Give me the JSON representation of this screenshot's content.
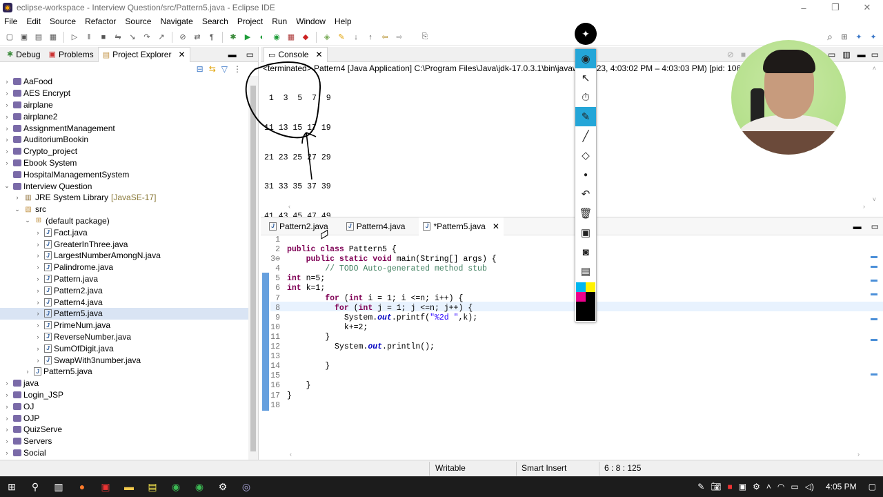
{
  "window": {
    "title": "eclipse-workspace - Interview Question/src/Pattern5.java - Eclipse IDE",
    "controls": [
      "–",
      "❐",
      "✕"
    ]
  },
  "menu": [
    "File",
    "Edit",
    "Source",
    "Refactor",
    "Source",
    "Navigate",
    "Search",
    "Project",
    "Run",
    "Window",
    "Help"
  ],
  "left_panel": {
    "tabs": [
      {
        "label": "Debug"
      },
      {
        "label": "Problems"
      },
      {
        "label": "Project Explorer",
        "close": "✕"
      }
    ],
    "tree": [
      {
        "label": "AaFood",
        "indent": 0,
        "type": "project"
      },
      {
        "label": "AES Encrypt",
        "indent": 0,
        "type": "project"
      },
      {
        "label": "airplane",
        "indent": 0,
        "type": "project"
      },
      {
        "label": "airplane2",
        "indent": 0,
        "type": "project"
      },
      {
        "label": "AssignmentManagement",
        "indent": 0,
        "type": "project"
      },
      {
        "label": "AuditoriumBookin",
        "indent": 0,
        "type": "project"
      },
      {
        "label": "Crypto_project",
        "indent": 0,
        "type": "project"
      },
      {
        "label": "Ebook System",
        "indent": 0,
        "type": "project"
      },
      {
        "label": "HospitalManagementSystem",
        "indent": 0,
        "type": "project-noarrow"
      },
      {
        "label": "Interview Question",
        "indent": 0,
        "type": "project-open"
      },
      {
        "label": "JRE System Library",
        "suffix": "[JavaSE-17]",
        "indent": 1,
        "type": "jre"
      },
      {
        "label": "src",
        "indent": 1,
        "type": "src-open"
      },
      {
        "label": "(default package)",
        "indent": 2,
        "type": "pkg-open"
      },
      {
        "label": "Fact.java",
        "indent": 3,
        "type": "java"
      },
      {
        "label": "GreaterInThree.java",
        "indent": 3,
        "type": "java"
      },
      {
        "label": "LargestNumberAmongN.java",
        "indent": 3,
        "type": "java"
      },
      {
        "label": "Palindrome.java",
        "indent": 3,
        "type": "java"
      },
      {
        "label": "Pattern.java",
        "indent": 3,
        "type": "java"
      },
      {
        "label": "Pattern2.java",
        "indent": 3,
        "type": "java"
      },
      {
        "label": "Pattern4.java",
        "indent": 3,
        "type": "java"
      },
      {
        "label": "Pattern5.java",
        "indent": 3,
        "type": "java",
        "selected": true
      },
      {
        "label": "PrimeNum.java",
        "indent": 3,
        "type": "java"
      },
      {
        "label": "ReverseNumber.java",
        "indent": 3,
        "type": "java"
      },
      {
        "label": "SumOfDigit.java",
        "indent": 3,
        "type": "java"
      },
      {
        "label": "SwapWith3number.java",
        "indent": 3,
        "type": "java"
      },
      {
        "label": "Pattern5.java",
        "indent": 2,
        "type": "java"
      },
      {
        "label": "java",
        "indent": 0,
        "type": "project"
      },
      {
        "label": "Login_JSP",
        "indent": 0,
        "type": "project"
      },
      {
        "label": "OJ",
        "indent": 0,
        "type": "project"
      },
      {
        "label": "OJP",
        "indent": 0,
        "type": "project"
      },
      {
        "label": "QuizServe",
        "indent": 0,
        "type": "project"
      },
      {
        "label": "Servers",
        "indent": 0,
        "type": "project"
      },
      {
        "label": "Social",
        "indent": 0,
        "type": "project"
      }
    ]
  },
  "console": {
    "tab_label": "Console",
    "header": "<terminated> Pattern4 [Java Application] C:\\Program Files\\Java\\jdk-17.0.3.1\\bin\\javaw.exe",
    "header_tail": "7, 2023, 4:03:02 PM – 4:03:03 PM) [pid: 1065",
    "output_rows": [
      " 1  3  5  7  9",
      "11 13 15 17 19",
      "21 23 25 27 29",
      "31 33 35 37 39",
      "41 43 45 47 49"
    ]
  },
  "editor": {
    "tabs": [
      {
        "label": "Pattern2.java"
      },
      {
        "label": "Pattern4.java"
      },
      {
        "label": "*Pattern5.java",
        "active": true,
        "close": "✕"
      }
    ],
    "line_numbers": [
      "1",
      "2",
      "3⊖",
      "4",
      "5",
      "6",
      "7",
      "8",
      "9",
      "10",
      "11",
      "12",
      "13",
      "14",
      "15",
      "16",
      "17",
      "18"
    ],
    "code_lines": [
      {
        "t": [
          {
            "s": ""
          }
        ]
      },
      {
        "t": [
          {
            "s": "public class ",
            "c": "kw"
          },
          {
            "s": "Pattern5 {"
          }
        ]
      },
      {
        "t": [
          {
            "s": "    "
          },
          {
            "s": "public static void ",
            "c": "kw"
          },
          {
            "s": "main(String[] args) {"
          }
        ]
      },
      {
        "t": [
          {
            "s": "        "
          },
          {
            "s": "// TODO Auto-generated method stub",
            "c": "cm"
          }
        ]
      },
      {
        "t": [
          {
            "s": "int ",
            "c": "kw"
          },
          {
            "s": "n=5;"
          }
        ]
      },
      {
        "t": [
          {
            "s": "int ",
            "c": "kw"
          },
          {
            "s": "k=1;"
          }
        ]
      },
      {
        "t": [
          {
            "s": "        "
          },
          {
            "s": "for ",
            "c": "kw"
          },
          {
            "s": "("
          },
          {
            "s": "int ",
            "c": "kw"
          },
          {
            "s": "i = 1; i <=n; i++) {"
          }
        ]
      },
      {
        "t": [
          {
            "s": "          "
          },
          {
            "s": "for ",
            "c": "kw"
          },
          {
            "s": "("
          },
          {
            "s": "int ",
            "c": "kw"
          },
          {
            "s": "j = 1; j <=n; j++) {"
          }
        ]
      },
      {
        "t": [
          {
            "s": "            System."
          },
          {
            "s": "out",
            "c": "it"
          },
          {
            "s": ".printf("
          },
          {
            "s": "\"%2d \"",
            "c": "st"
          },
          {
            "s": ",k);"
          }
        ]
      },
      {
        "t": [
          {
            "s": "            k+=2;"
          }
        ]
      },
      {
        "t": [
          {
            "s": "        }"
          }
        ]
      },
      {
        "t": [
          {
            "s": "          System."
          },
          {
            "s": "out",
            "c": "it"
          },
          {
            "s": ".println();"
          }
        ]
      },
      {
        "t": [
          {
            "s": ""
          }
        ]
      },
      {
        "t": [
          {
            "s": "        }"
          }
        ]
      },
      {
        "t": [
          {
            "s": ""
          }
        ]
      },
      {
        "t": [
          {
            "s": "    }"
          }
        ]
      },
      {
        "t": [
          {
            "s": "}"
          }
        ]
      },
      {
        "t": [
          {
            "s": ""
          }
        ]
      }
    ]
  },
  "status": {
    "writable": "Writable",
    "insert_mode": "Smart Insert",
    "position": "6 : 8 : 125"
  },
  "taskbar": {
    "time": "4:05 PM"
  },
  "annotation_tools": [
    "eye-icon",
    "cursor-icon",
    "timer-icon",
    "highlighter-icon",
    "pen-icon",
    "eraser-icon",
    "dot-icon",
    "undo-icon",
    "trash-icon",
    "whiteboard-icon",
    "camera-icon",
    "clipboard-icon",
    "color-palette"
  ],
  "colors": {
    "keyword": "#7f0055",
    "comment": "#3f7f5f",
    "string": "#2a00ff",
    "field": "#0000c0",
    "annot_active": "#24a6d8",
    "taskbar": "#1c1c1c"
  }
}
